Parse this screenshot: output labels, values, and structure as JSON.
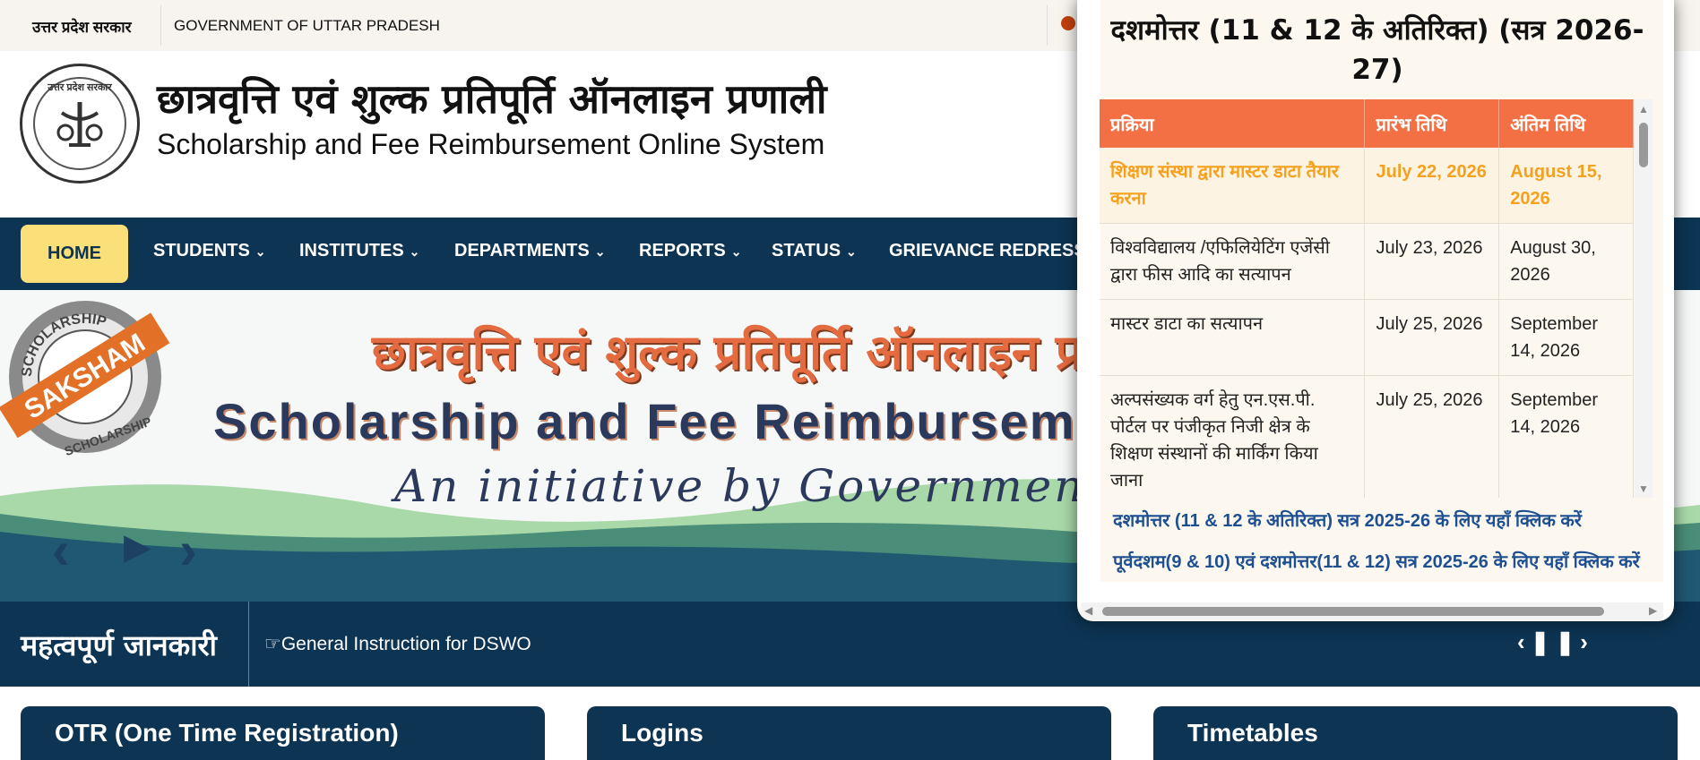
{
  "topbar": {
    "hindi_gov": "उत्तर प्रदेश सरकार",
    "english_gov": "GOVERNMENT OF UTTAR PRADESH"
  },
  "header": {
    "title_hindi": "छात्रवृत्ति एवं शुल्क प्रतिपूर्ति ऑनलाइन प्रणाली",
    "title_english": "Scholarship and Fee Reimbursement Online System",
    "logo_text": "उत्तर प्रदेश सरकार"
  },
  "nav": {
    "home": "HOME",
    "items": [
      "STUDENTS",
      "INSTITUTES",
      "DEPARTMENTS",
      "REPORTS",
      "STATUS",
      "GRIEVANCE REDRESSAL"
    ],
    "chevron": "⌄"
  },
  "banner": {
    "seal_top": "SCHOLARSHIP",
    "seal_band": "SAKSHAM",
    "seal_bottom": "SCHOLARSHIP",
    "hindi": "छात्रवृत्ति एवं शुल्क प्रतिपूर्ति ऑनलाइन प्रणाली",
    "english": "Scholarship and Fee Reimbursement Online System",
    "tagline": "An initiative by Government of Uttar Pradesh",
    "controls": {
      "prev": "‹",
      "play": "▶",
      "next": "›"
    }
  },
  "info": {
    "heading": "महत्वपूर्ण जानकारी",
    "ticker": "☞General Instruction for DSWO",
    "controls": "‹❚❚›"
  },
  "cards": [
    "OTR (One Time Registration)",
    "Logins",
    "Timetables"
  ],
  "popup": {
    "title": "दशमोत्तर (11 & 12 के अतिरिक्त) (सत्र 2026-27)",
    "headers": [
      "प्रक्रिया",
      "प्रारंभ तिथि",
      "अंतिम तिथि"
    ],
    "rows": [
      [
        "शिक्षण संस्था द्वारा मास्टर डाटा तैयार करना",
        "July 22, 2026",
        "August 15, 2026"
      ],
      [
        "विश्वविद्यालय /एफिलियेटिंग एजेंसी द्वारा फीस आदि का सत्यापन",
        "July 23, 2026",
        "August 30, 2026"
      ],
      [
        "मास्टर डाटा का सत्यापन",
        "July 25, 2026",
        "September 14, 2026"
      ],
      [
        "अल्पसंख्यक वर्ग हेतु एन.एस.पी. पोर्टल पर पंजीकृत निजी क्षेत्र के शिक्षण संस्थानों की मार्किंग किया जाना",
        "July 25, 2026",
        "September 14, 2026"
      ]
    ],
    "link1": "दशमोत्तर (11 & 12 के अतिरिक्त) सत्र 2025-26 के लिए यहाँ क्लिक करें",
    "link2": "पूर्वदशम(9 & 10) एवं दशमोत्तर(11 & 12) सत्र 2025-26 के लिए यहाँ क्लिक करें"
  },
  "colors": {
    "navy": "#0d3452",
    "home_yellow": "#fbe07a",
    "table_header": "#f37044",
    "highlight_text": "#f3a11f",
    "link_blue": "#1d4f91"
  }
}
